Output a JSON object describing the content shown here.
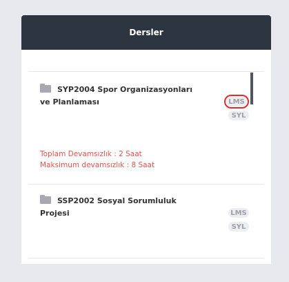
{
  "panel": {
    "title": "Dersler"
  },
  "courses": [
    {
      "title_line1": "SYP2004 Spor Organizasyonları",
      "title_line2": "ve Planlaması",
      "lms_label": "LMS",
      "syl_label": "SYL",
      "attendance_total": "Toplam Devamsızlık : 2 Saat",
      "attendance_max": "Maksimum devamsızlık : 8 Saat"
    },
    {
      "title_line1": "SSP2002 Sosyal Sorumluluk",
      "title_line2": "Projesi",
      "lms_label": "LMS",
      "syl_label": "SYL"
    }
  ],
  "colors": {
    "header_bg": "#2c3440",
    "attendance_text": "#e5534b",
    "highlight": "#e52a2a"
  },
  "icons": {
    "course": "folder-icon"
  }
}
